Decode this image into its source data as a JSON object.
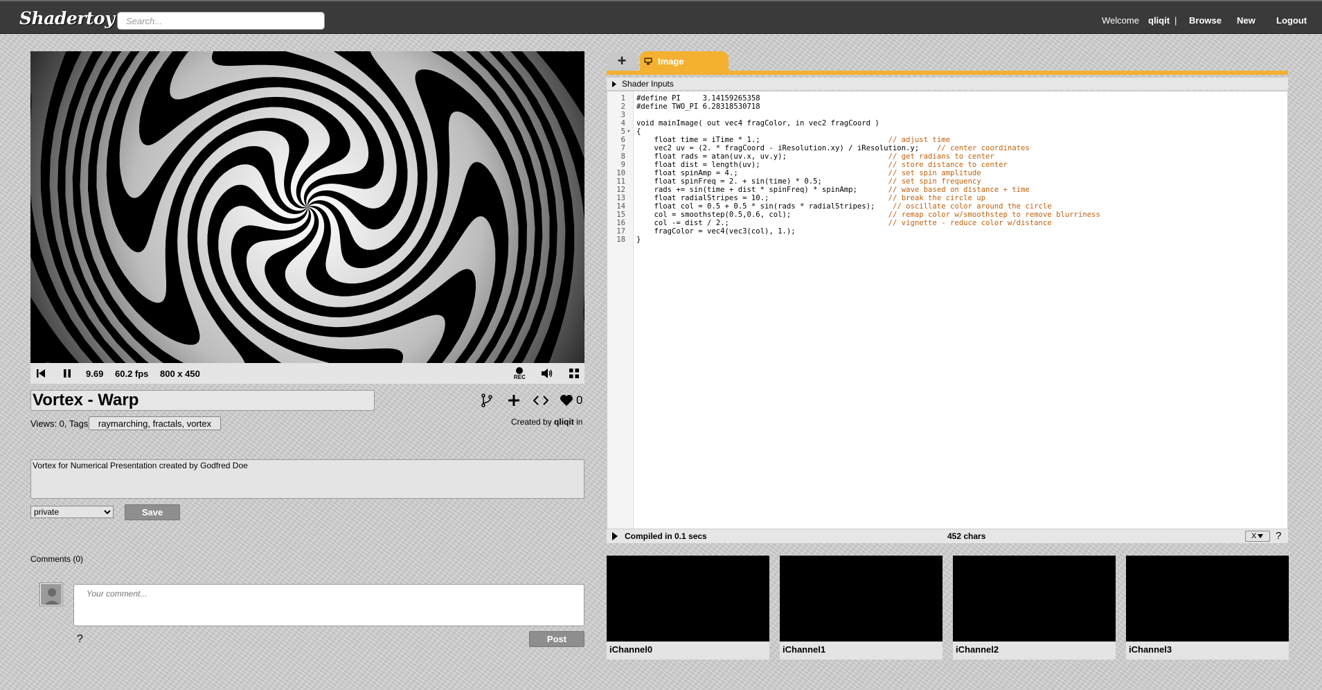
{
  "header": {
    "logo": "Shadertoy",
    "search_placeholder": "Search...",
    "welcome": "Welcome",
    "username": "qliqit",
    "separator": "|",
    "browse": "Browse",
    "new": "New",
    "logout": "Logout"
  },
  "player": {
    "time": "9.69",
    "fps": "60.2 fps",
    "resolution": "800 x 450",
    "rec_label": "REC"
  },
  "shader": {
    "title": "Vortex - Warp",
    "likes": "0",
    "views_label": "Views: 0, Tags:",
    "tags": "raymarching, fractals, vortex",
    "created_by": "Created by",
    "author": "qliqit",
    "created_suffix": "in",
    "description": "Vortex for Numerical Presentation created by Godfred Doe",
    "privacy": "private",
    "privacy_options": [
      "private"
    ],
    "save_label": "Save"
  },
  "comments": {
    "label": "Comments (0)",
    "placeholder": "Your comment...",
    "help": "?",
    "post_label": "Post"
  },
  "editor": {
    "tab_add": "+",
    "tab_image": "Image",
    "shader_inputs": "Shader Inputs",
    "lines": [
      {
        "n": "1",
        "t": "#define PI     3.14159265358"
      },
      {
        "n": "2",
        "t": "#define TWO_PI 6.28318530718"
      },
      {
        "n": "3",
        "t": ""
      },
      {
        "n": "4",
        "t": "void mainImage( out vec4 fragColor, in vec2 fragCoord )"
      },
      {
        "n": "5",
        "t": "{"
      },
      {
        "n": "6",
        "t": "    float time = iTime * 1.;",
        "c": "// adjust time"
      },
      {
        "n": "7",
        "t": "    vec2 uv = (2. * fragCoord - iResolution.xy) / iResolution.y;",
        "c": "// center coordinates"
      },
      {
        "n": "8",
        "t": "    float rads = atan(uv.x, uv.y);",
        "c": "// get radians to center"
      },
      {
        "n": "9",
        "t": "    float dist = length(uv);",
        "c": "// store distance to center"
      },
      {
        "n": "10",
        "t": "    float spinAmp = 4.;",
        "c": "// set spin amplitude"
      },
      {
        "n": "11",
        "t": "    float spinFreq = 2. + sin(time) * 0.5;",
        "c": "// set spin frequency"
      },
      {
        "n": "12",
        "t": "    rads += sin(time + dist * spinFreq) * spinAmp;",
        "c": "// wave based on distance + time"
      },
      {
        "n": "13",
        "t": "    float radialStripes = 10.;",
        "c": "// break the circle up"
      },
      {
        "n": "14",
        "t": "    float col = 0.5 + 0.5 * sin(rads * radialStripes);",
        "c": "// oscillate color around the circle"
      },
      {
        "n": "15",
        "t": "    col = smoothstep(0.5,0.6, col);",
        "c": "// remap color w/smoothstep to remove blurriness"
      },
      {
        "n": "16",
        "t": "    col -= dist / 2.;",
        "c": "// vignette - reduce color w/distance"
      },
      {
        "n": "17",
        "t": "    fragColor = vec4(vec3(col), 1.);"
      },
      {
        "n": "18",
        "t": "}"
      }
    ],
    "compiled": "Compiled in 0.1 secs",
    "chars": "452 chars",
    "font_select": "X",
    "help": "?"
  },
  "channels": [
    {
      "label": "iChannel0"
    },
    {
      "label": "iChannel1"
    },
    {
      "label": "iChannel2"
    },
    {
      "label": "iChannel3"
    }
  ],
  "colors": {
    "accent": "#f4b030",
    "header_bg": "#3a3a3a",
    "button_gray": "#8e8e8e"
  }
}
